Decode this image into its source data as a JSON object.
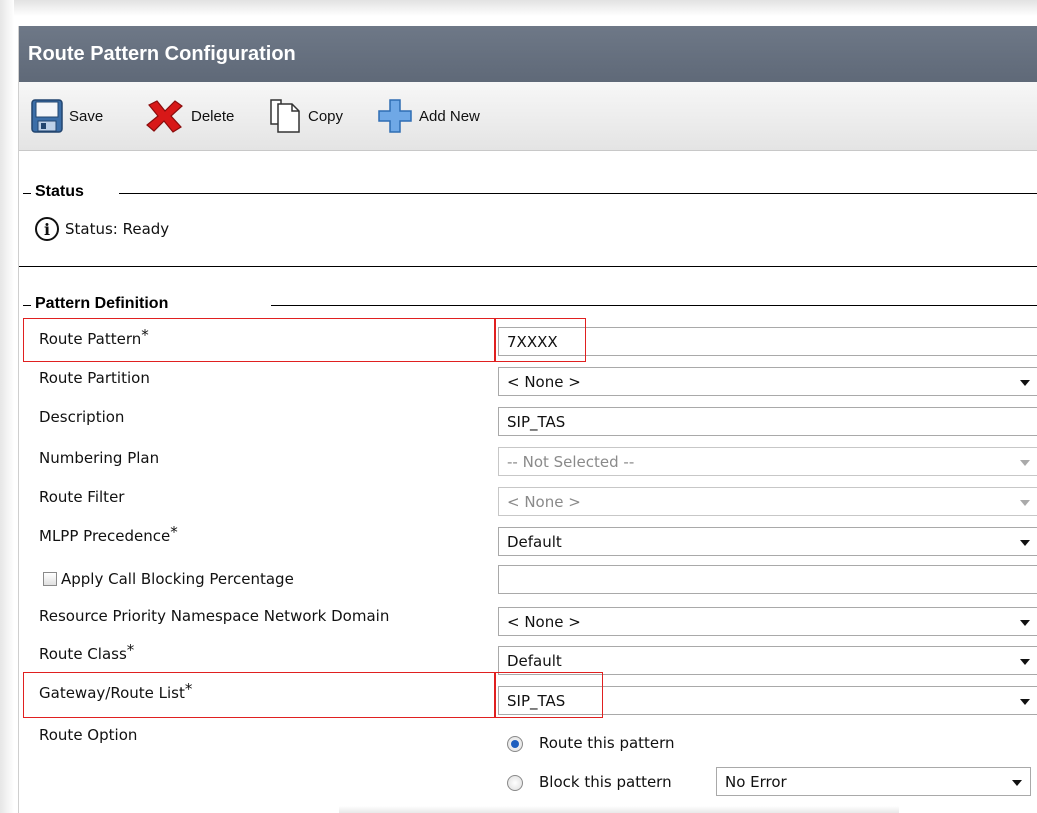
{
  "window": {
    "title": "Route Pattern Configuration"
  },
  "toolbar": {
    "save_label": "Save",
    "delete_label": "Delete",
    "copy_label": "Copy",
    "add_new_label": "Add New",
    "icons": [
      "save-disk-icon",
      "delete-x-icon",
      "copy-page-icon",
      "add-plus-icon"
    ],
    "colors": {
      "save": "#3b6ea8",
      "delete": "#d81818",
      "add": "#4a90d9"
    }
  },
  "status": {
    "legend": "Status",
    "icon": "info-icon",
    "text": "Status: Ready"
  },
  "pattern_definition": {
    "legend": "Pattern Definition",
    "required_marker": "*",
    "fields": {
      "route_pattern": {
        "label": "Route Pattern",
        "value": "7XXXX"
      },
      "route_partition": {
        "label": "Route Partition",
        "value": "< None >"
      },
      "description": {
        "label": "Description",
        "value": "SIP_TAS"
      },
      "numbering_plan": {
        "label": "Numbering Plan",
        "value": "-- Not Selected --"
      },
      "route_filter": {
        "label": "Route Filter",
        "value": "< None >"
      },
      "mlpp_precedence": {
        "label": "MLPP Precedence",
        "value": "Default"
      },
      "apply_call_blocking": {
        "label": "Apply Call Blocking Percentage",
        "checked": false,
        "value": ""
      },
      "resource_priority": {
        "label": "Resource Priority Namespace Network Domain",
        "value": "< None >"
      },
      "route_class": {
        "label": "Route Class",
        "value": "Default"
      },
      "gateway_route_list": {
        "label": "Gateway/Route List",
        "value": "SIP_TAS"
      },
      "route_option": {
        "label": "Route Option",
        "route_this_pattern": "Route this pattern",
        "block_this_pattern": "Block this pattern",
        "block_reason": "No Error",
        "selected": "route_this_pattern"
      }
    }
  },
  "highlight_color": "#e02020"
}
